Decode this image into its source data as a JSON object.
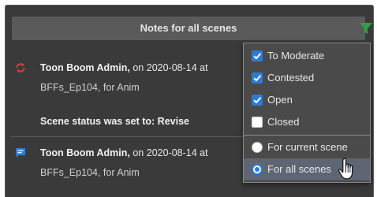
{
  "header": {
    "title": "Notes for all scenes",
    "filter_icon": "filter-icon",
    "filter_color": "#2ea043"
  },
  "notes": [
    {
      "icon": "sync-icon",
      "icon_color": "#e53935",
      "author": "Toon Boom Admin,",
      "date_text": "on 2020-08-14 at",
      "meta": "BFFs_Ep104, for Anim",
      "status": "Scene status was set to: Revise"
    },
    {
      "icon": "comment-icon",
      "icon_color": "#2e7bd6",
      "author": "Toon Boom Admin,",
      "date_text": "on 2020-08-14 at",
      "meta": "BFFs_Ep104, for Anim"
    }
  ],
  "filter_menu": {
    "checkboxes": [
      {
        "label": "To Moderate",
        "checked": true
      },
      {
        "label": "Contested",
        "checked": true
      },
      {
        "label": "Open",
        "checked": true
      },
      {
        "label": "Closed",
        "checked": false
      }
    ],
    "radios": [
      {
        "label": "For current scene",
        "selected": false
      },
      {
        "label": "For all scenes",
        "selected": true
      }
    ]
  },
  "colors": {
    "accent": "#2e7bd6",
    "panel_bg": "#3a3a3a",
    "header_bg": "#5a5a5a"
  }
}
